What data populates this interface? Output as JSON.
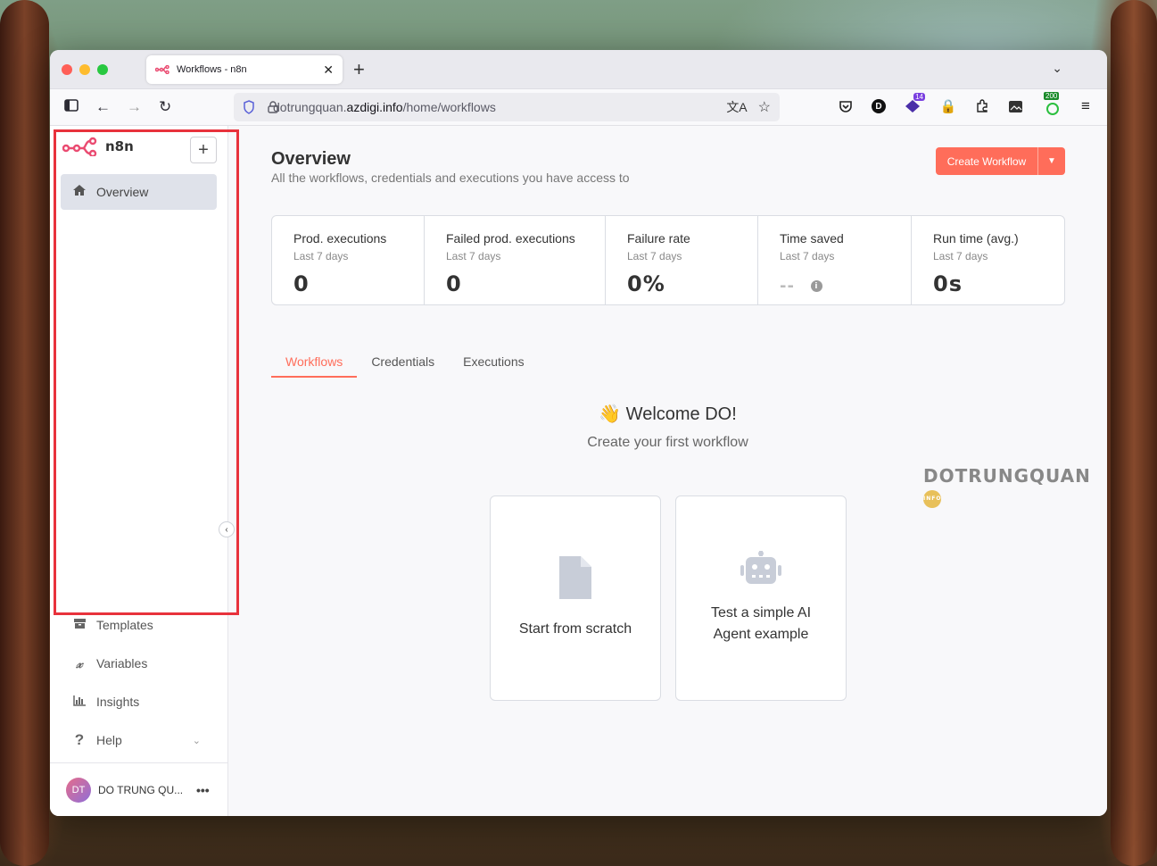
{
  "browser": {
    "tab_title": "Workflows - n8n",
    "url_prefix": "dotrungquan.",
    "url_domain": "azdigi.info",
    "url_path": "/home/workflows",
    "ext_badge_1": "14",
    "ext_badge_2": "200",
    "ext_d_label": "D"
  },
  "sidebar": {
    "brand": "n8n",
    "add_label": "+",
    "items": [
      {
        "label": "Overview",
        "icon": "home-icon"
      },
      {
        "label": "Templates",
        "icon": "box-icon"
      },
      {
        "label": "Variables",
        "icon": "variable-x-icon"
      },
      {
        "label": "Insights",
        "icon": "bar-chart-icon"
      },
      {
        "label": "Help",
        "icon": "question-icon"
      }
    ],
    "user": {
      "initials": "DT",
      "name": "DO TRUNG QU..."
    }
  },
  "main": {
    "title": "Overview",
    "subtitle": "All the workflows, credentials and executions you have access to",
    "create_button": "Create Workflow",
    "stats": [
      {
        "title": "Prod. executions",
        "sub": "Last 7 days",
        "value": "0"
      },
      {
        "title": "Failed prod. executions",
        "sub": "Last 7 days",
        "value": "0"
      },
      {
        "title": "Failure rate",
        "sub": "Last 7 days",
        "value": "0%"
      },
      {
        "title": "Time saved",
        "sub": "Last 7 days",
        "value": "--"
      },
      {
        "title": "Run time (avg.)",
        "sub": "Last 7 days",
        "value": "0s"
      }
    ],
    "tabs": [
      "Workflows",
      "Credentials",
      "Executions"
    ],
    "welcome": "👋 Welcome DO!",
    "welcome_sub": "Create your first workflow",
    "cards": [
      {
        "label": "Start from scratch"
      },
      {
        "label": "Test a simple AI Agent example"
      }
    ],
    "watermark": "DOTRUNGQUAN",
    "watermark_badge": "INFO"
  },
  "colors": {
    "accent": "#ff6d5a",
    "highlight": "#e8323c"
  }
}
